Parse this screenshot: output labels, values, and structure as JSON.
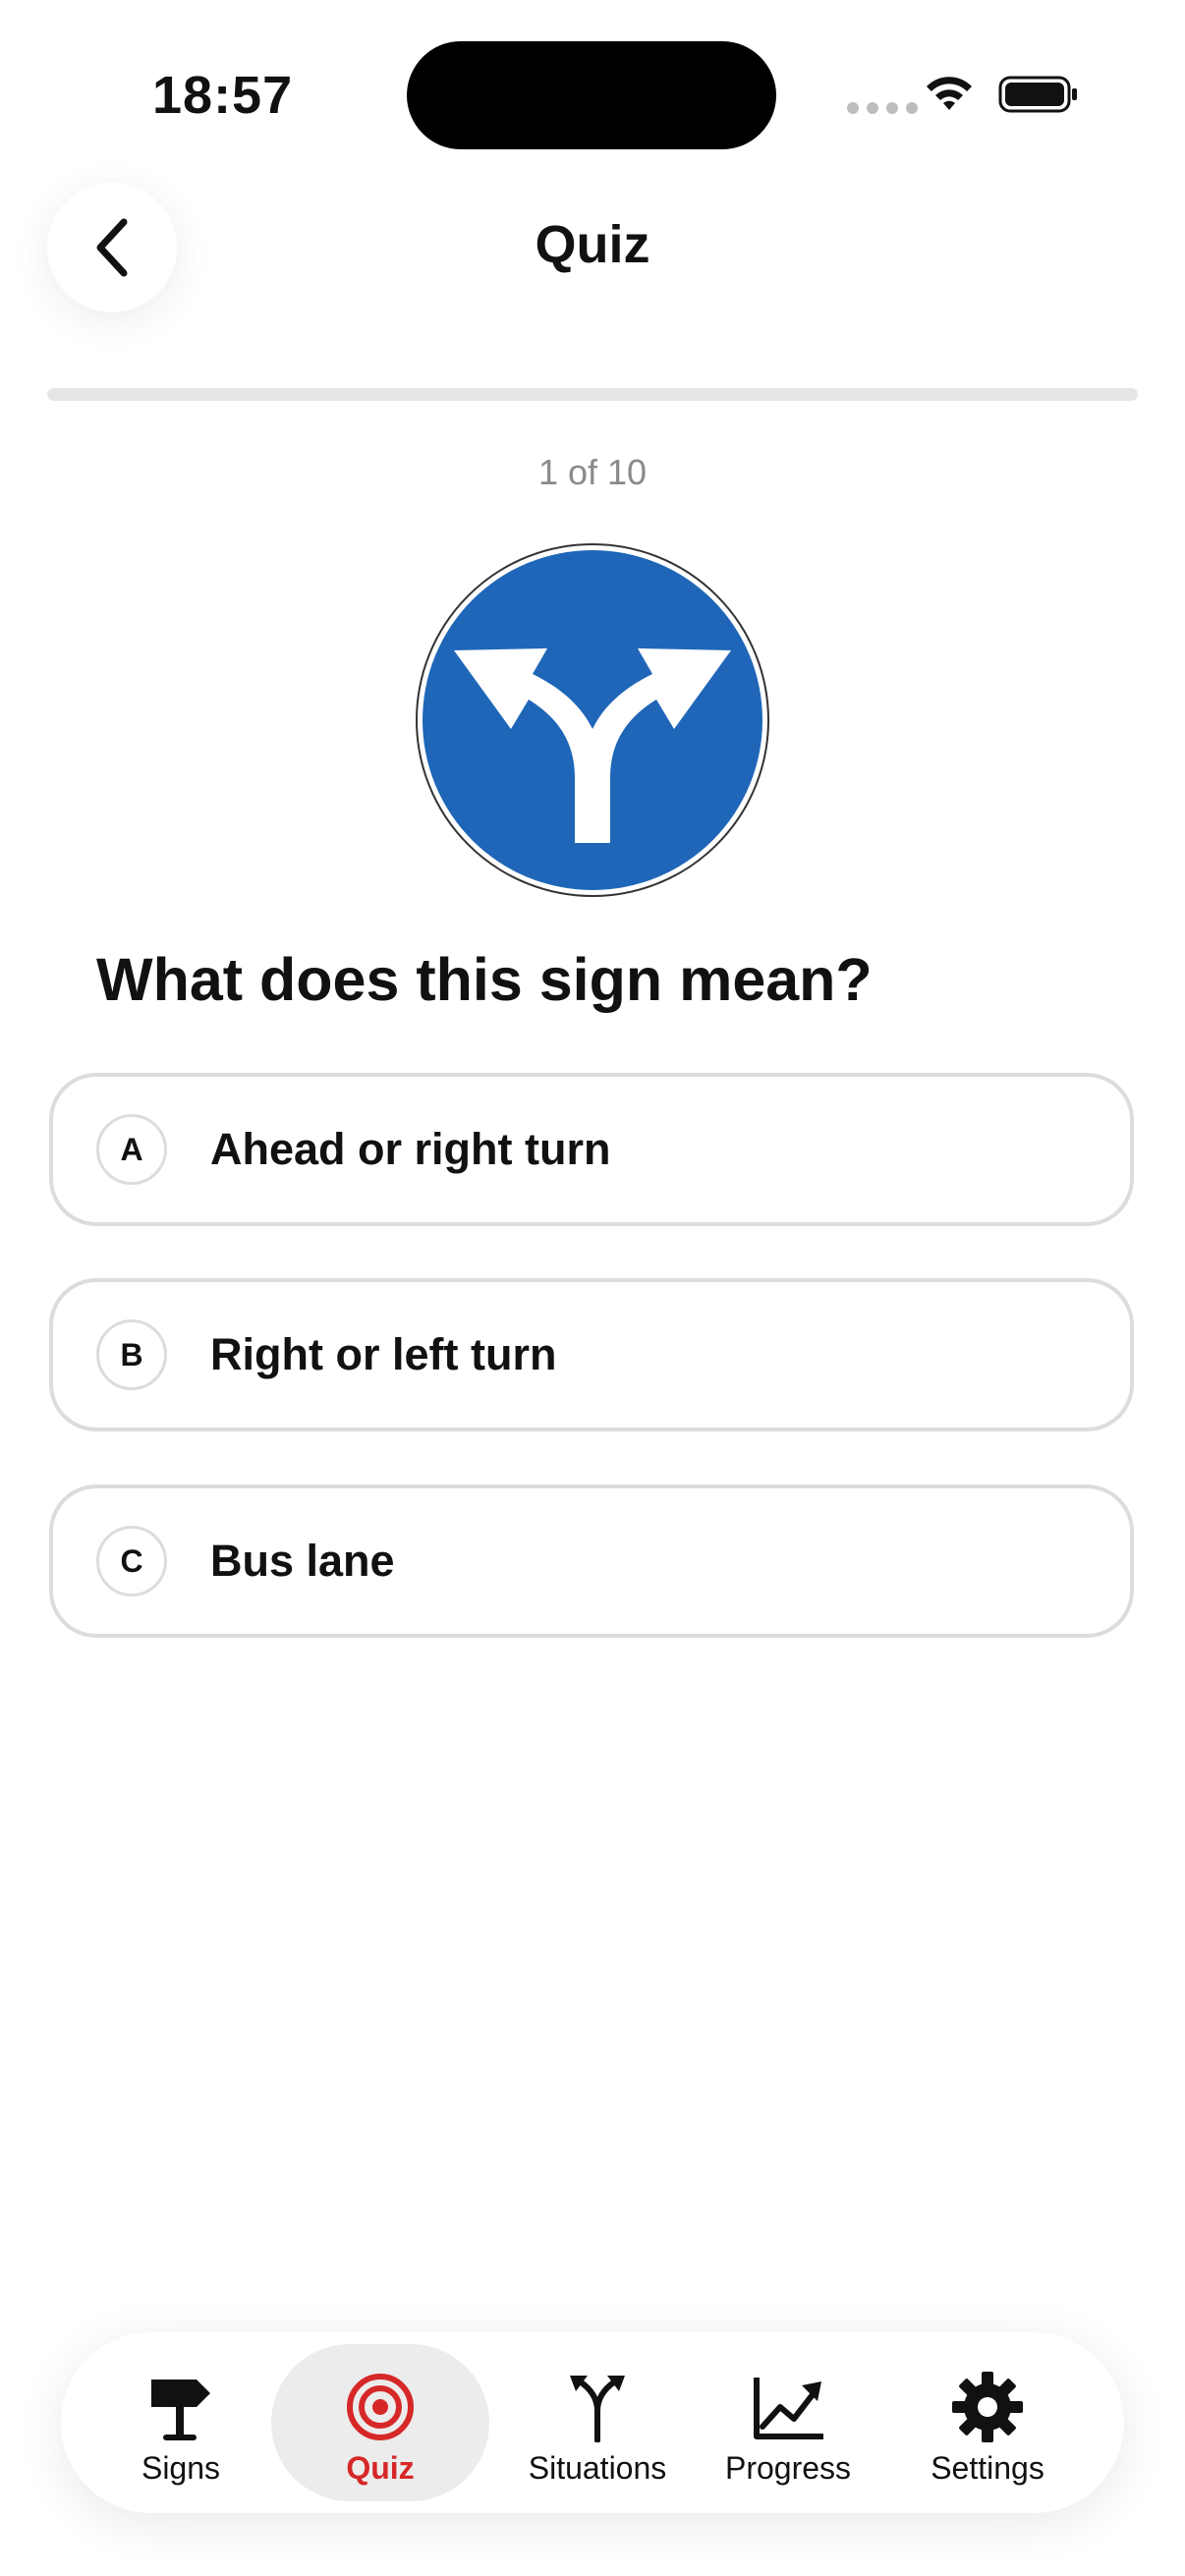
{
  "status_bar": {
    "time": "18:57"
  },
  "header": {
    "title": "Quiz"
  },
  "quiz": {
    "progress_fraction": 0.0,
    "counter": "1 of 10",
    "sign_icon": "road-sign-turn-left-or-right-icon",
    "question": "What does this sign mean?",
    "options": [
      {
        "letter": "A",
        "text": "Ahead or right turn"
      },
      {
        "letter": "B",
        "text": "Right or left turn"
      },
      {
        "letter": "C",
        "text": "Bus lane"
      }
    ]
  },
  "tab_bar": {
    "active": "Quiz",
    "tabs": [
      {
        "label": "Signs",
        "icon": "signpost-icon"
      },
      {
        "label": "Quiz",
        "icon": "target-icon"
      },
      {
        "label": "Situations",
        "icon": "fork-arrow-icon"
      },
      {
        "label": "Progress",
        "icon": "chart-line-icon"
      },
      {
        "label": "Settings",
        "icon": "gear-icon"
      }
    ]
  },
  "colors": {
    "accent": "#d62828",
    "sign_blue": "#1f66b8",
    "border": "#dcdcdc"
  }
}
